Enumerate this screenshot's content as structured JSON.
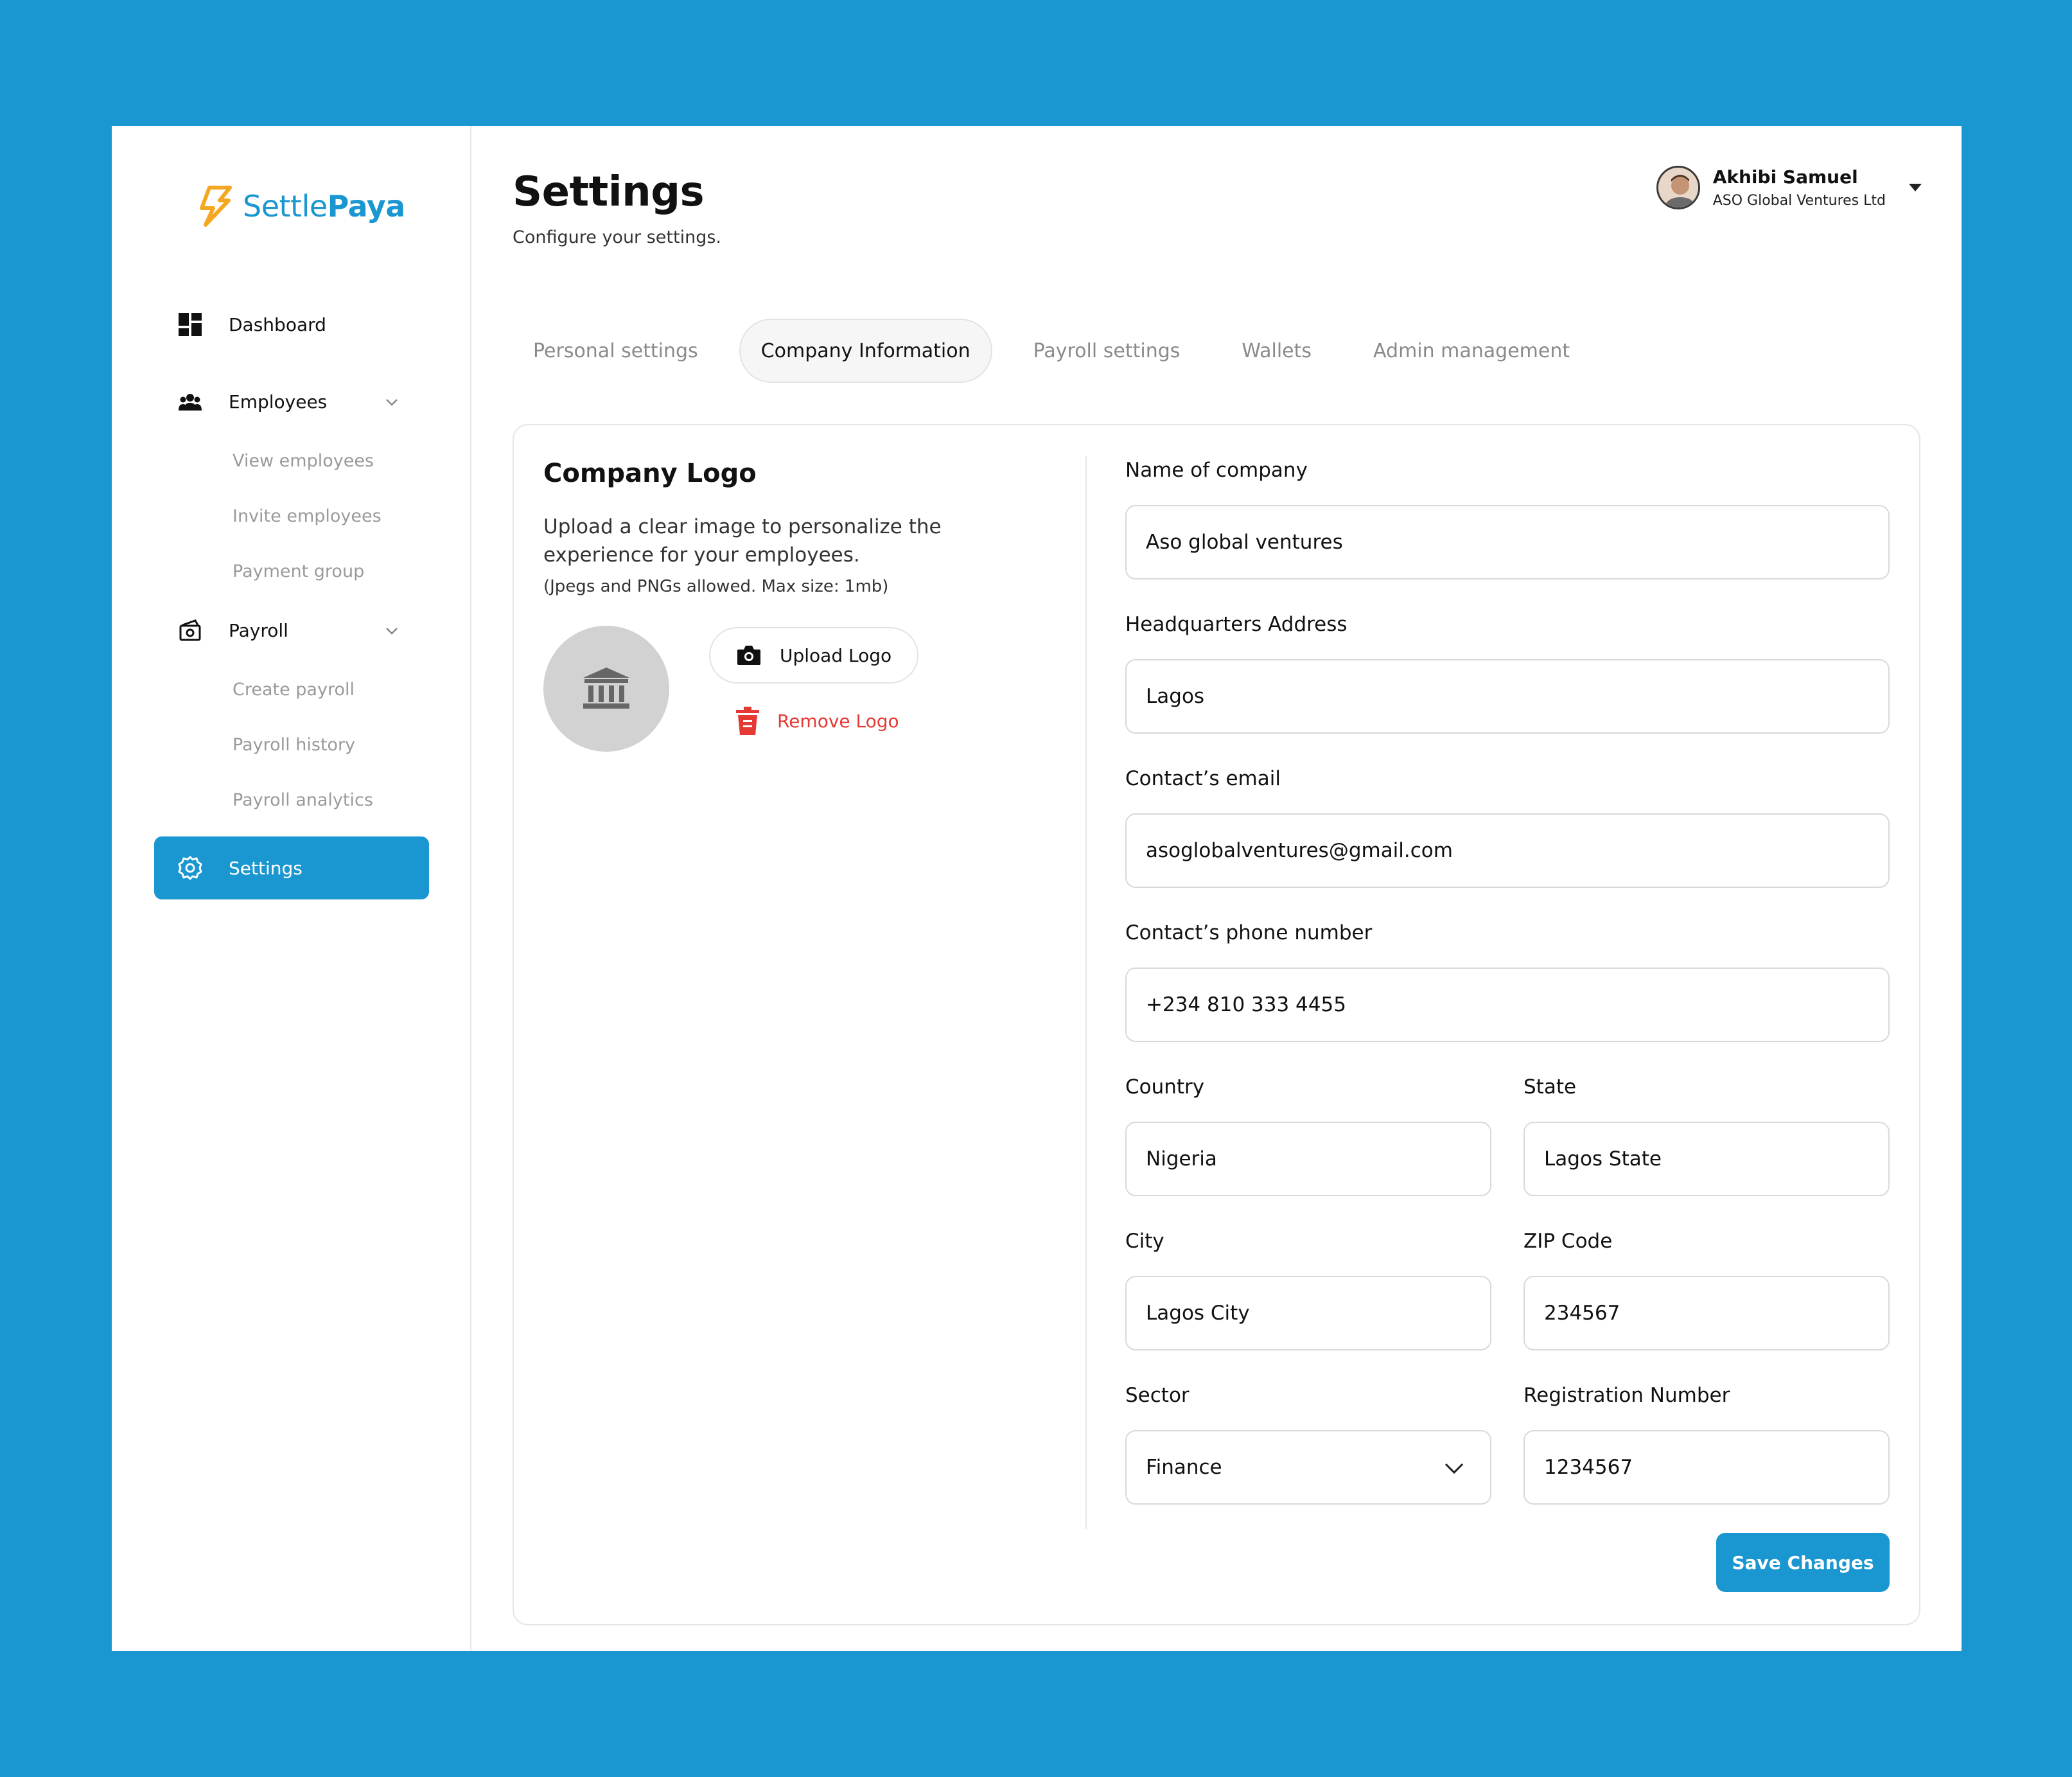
{
  "brand": {
    "name_part1": "Settle",
    "name_part2": "Paya",
    "accent": "#1a97d0",
    "logo_color": "#f5a623"
  },
  "sidebar": {
    "dashboard": {
      "label": "Dashboard",
      "icon": "grid-icon"
    },
    "employees": {
      "label": "Employees",
      "icon": "people-icon",
      "sub": [
        "View employees",
        "Invite employees",
        "Payment group"
      ]
    },
    "payroll": {
      "label": "Payroll",
      "icon": "money-icon",
      "sub": [
        "Create payroll",
        "Payroll history",
        "Payroll analytics"
      ]
    },
    "settings": {
      "label": "Settings",
      "icon": "gear-icon"
    }
  },
  "header": {
    "title": "Settings",
    "subtitle": "Configure your settings.",
    "user_name": "Akhibi Samuel",
    "user_company": "ASO Global Ventures Ltd"
  },
  "tabs": [
    "Personal settings",
    "Company Information",
    "Payroll settings",
    "Wallets",
    "Admin management"
  ],
  "logo_section": {
    "title": "Company Logo",
    "description": "Upload a clear image to personalize the experience for your employees.",
    "hint": "(Jpegs and PNGs allowed. Max size: 1mb)",
    "upload_label": "Upload Logo",
    "remove_label": "Remove Logo"
  },
  "form": {
    "company_name": {
      "label": "Name of company",
      "value": "Aso global ventures"
    },
    "hq_address": {
      "label": "Headquarters Address",
      "value": "Lagos"
    },
    "contact_email": {
      "label": "Contact’s email",
      "value": "asoglobalventures@gmail.com"
    },
    "contact_phone": {
      "label": "Contact’s phone number",
      "value": "+234 810 333 4455"
    },
    "country": {
      "label": "Country",
      "value": "Nigeria"
    },
    "state": {
      "label": "State",
      "value": "Lagos State"
    },
    "city": {
      "label": "City",
      "value": "Lagos City"
    },
    "zip": {
      "label": "ZIP Code",
      "value": "234567"
    },
    "sector": {
      "label": "Sector",
      "value": "Finance"
    },
    "registration": {
      "label": "Registration Number",
      "value": "1234567"
    },
    "save_label": "Save Changes"
  }
}
